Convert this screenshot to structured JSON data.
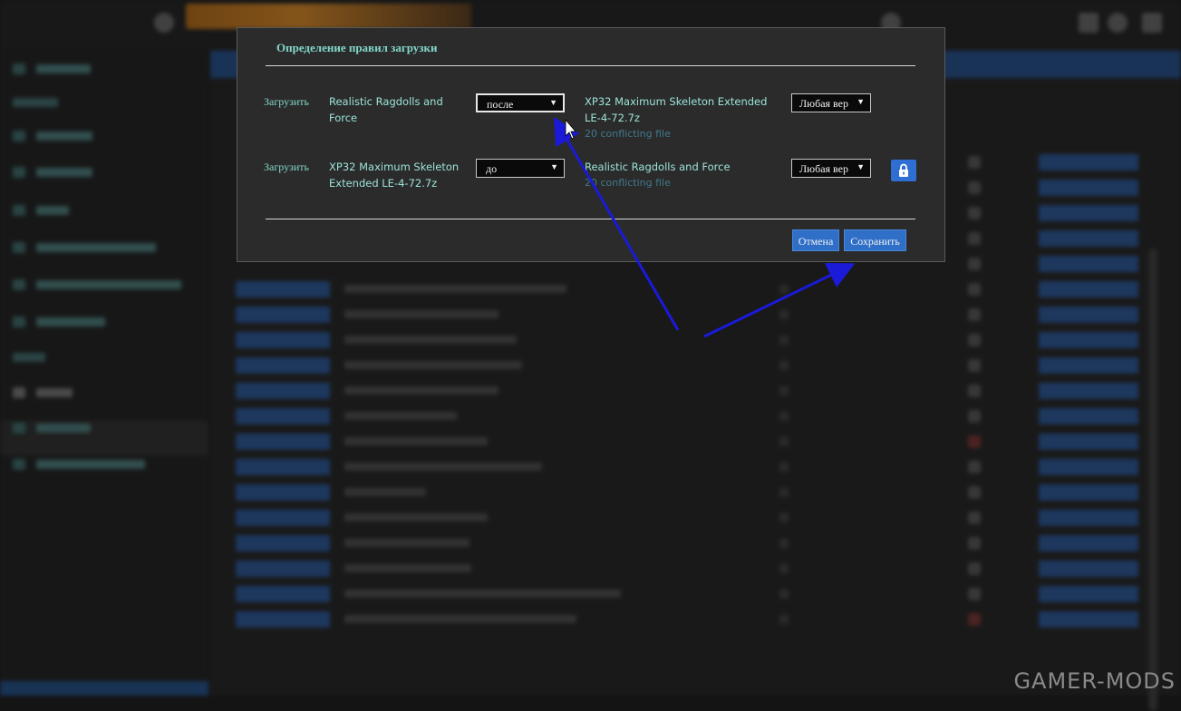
{
  "dialog": {
    "title": "Определение правил загрузки",
    "rules": [
      {
        "action_label": "Загрузить",
        "mod_name": "Realistic Ragdolls and Force",
        "order_value": "после",
        "target_mod": "XP32 Maximum Skeleton Extended LE-4-72.7z",
        "target_conflicts": "20 conflicting file",
        "version_value": "Любая вер"
      },
      {
        "action_label": "Загрузить",
        "mod_name": "XP32 Maximum Skeleton Extended LE-4-72.7z",
        "order_value": "до",
        "target_mod": "Realistic Ragdolls and Force",
        "target_conflicts": "20 conflicting file",
        "version_value": "Любая вер"
      }
    ],
    "cancel_label": "Отмена",
    "save_label": "Сохранить",
    "lock_icon": "lock-icon"
  },
  "watermark": "GAMER-MODS",
  "colors": {
    "accent_text": "#82d8cb",
    "button_blue": "#2f6fc8",
    "annotation_arrow": "#1a1ad8"
  }
}
